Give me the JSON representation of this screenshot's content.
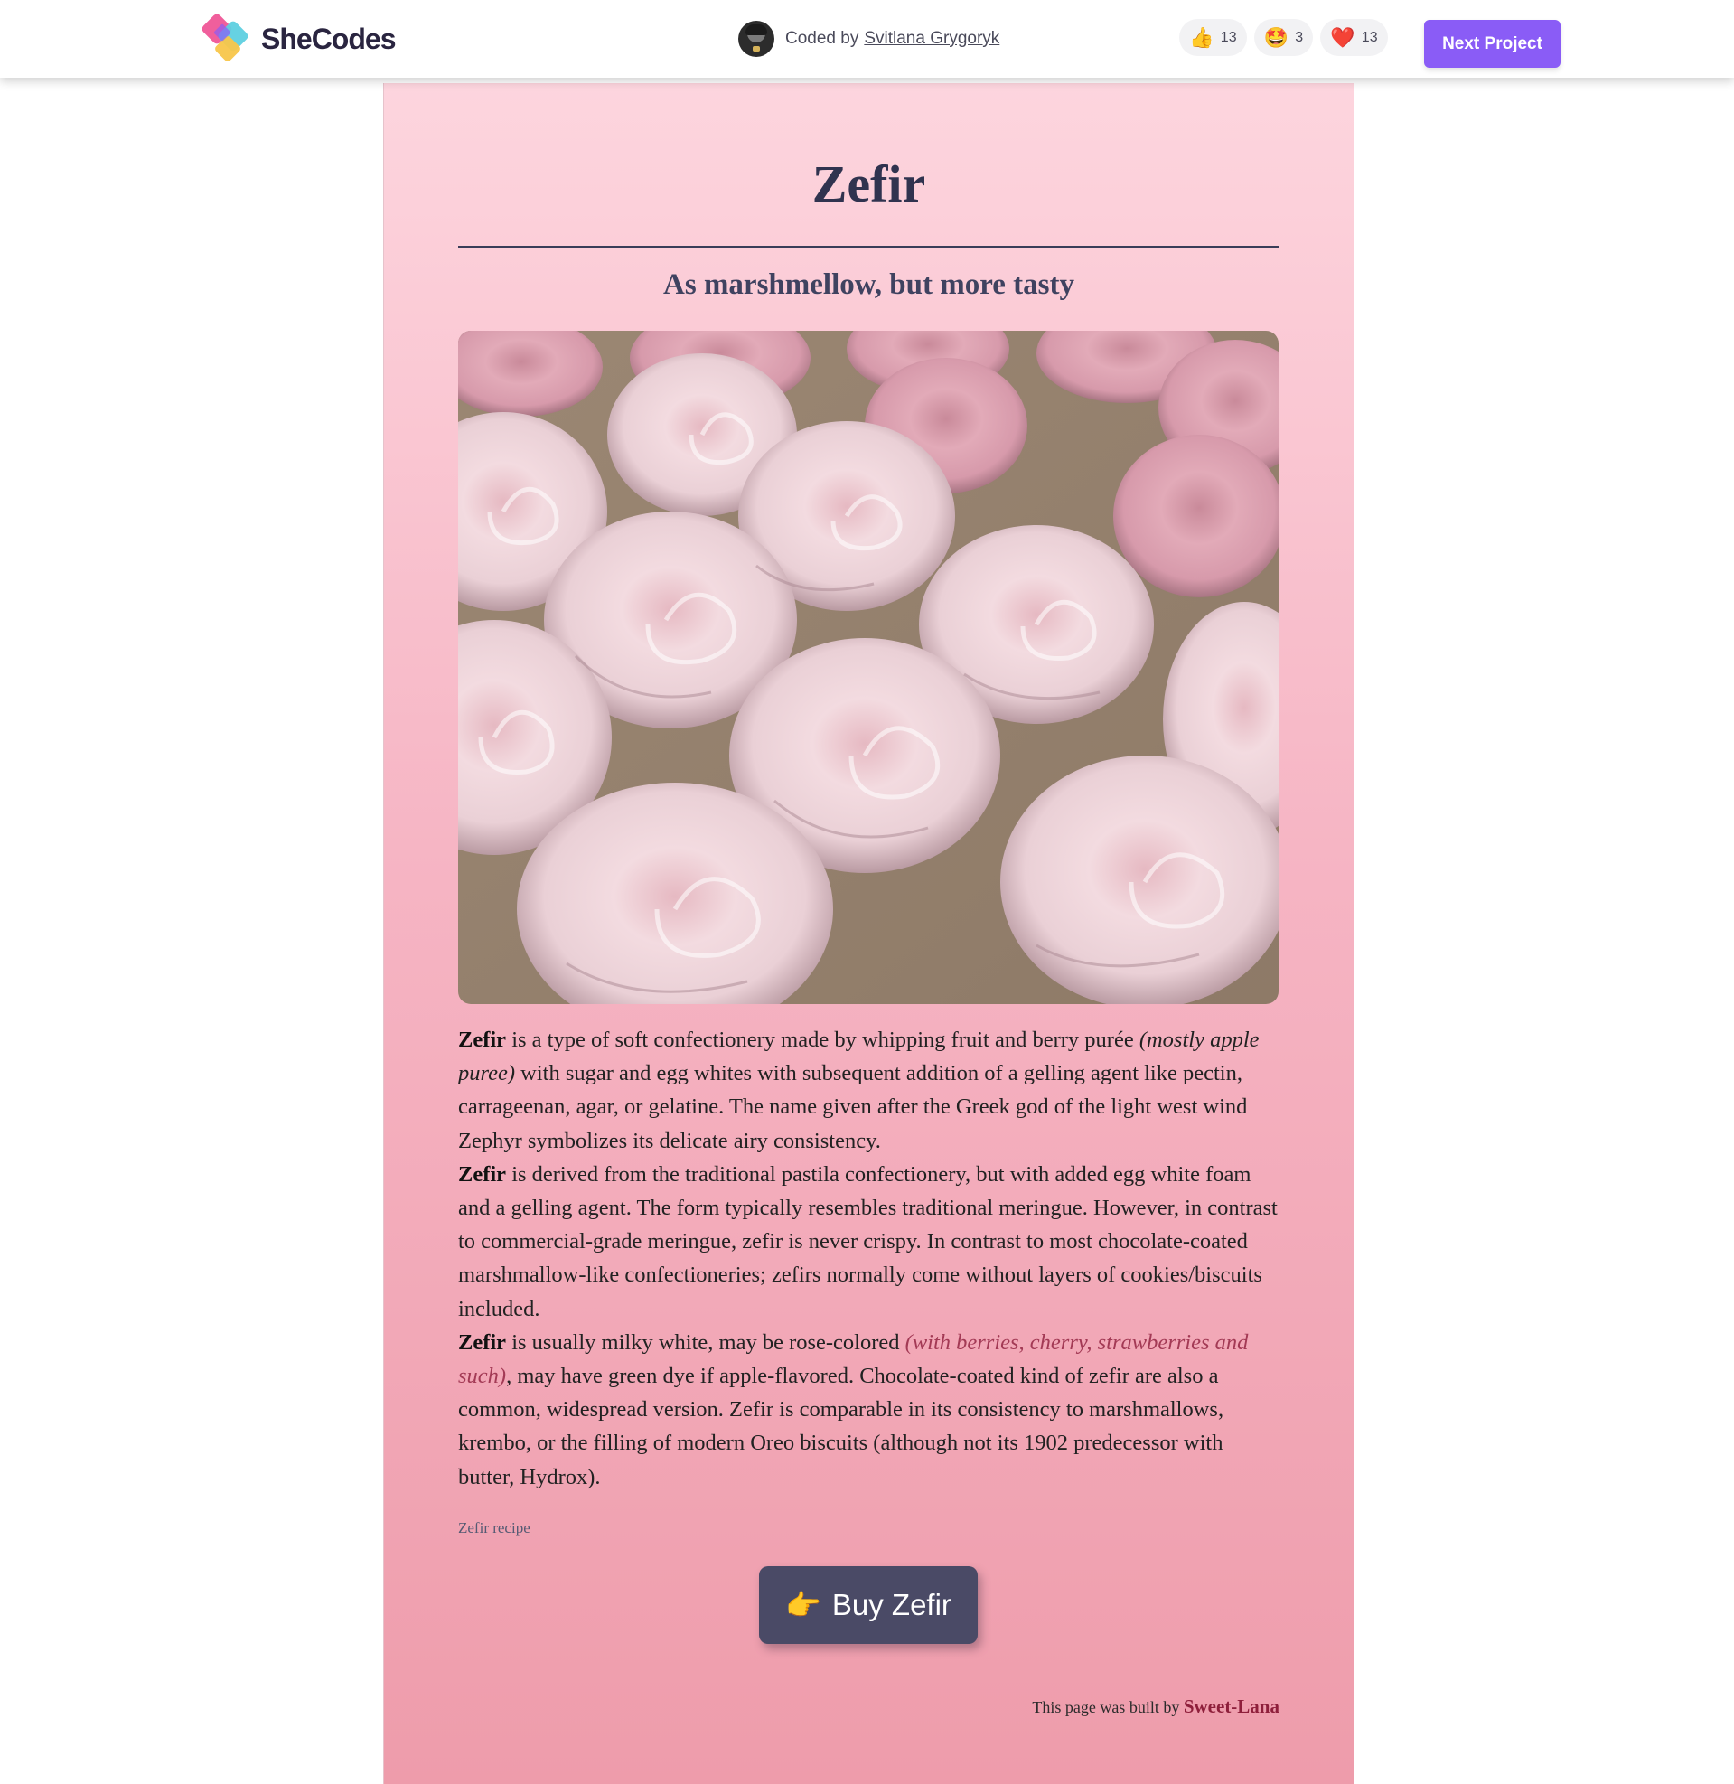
{
  "header": {
    "brand": "SheCodes",
    "coded_by_label": "Coded by",
    "author": "Svitlana Grygoryk",
    "reactions": [
      {
        "icon": "thumbs-up",
        "emoji": "👍",
        "count": "13"
      },
      {
        "icon": "star-struck",
        "emoji": "🤩",
        "count": "3"
      },
      {
        "icon": "heart",
        "emoji": "❤️",
        "count": "13"
      }
    ],
    "next_button": "Next Project"
  },
  "page": {
    "title": "Zefir",
    "subtitle": "As marshmellow, but more tasty",
    "paragraphs": [
      {
        "lead": "Zefir",
        "text_1": " is a type of soft confectionery made by whipping fruit and berry purée ",
        "aside": "(mostly apple puree)",
        "text_2": " with sugar and egg whites with subsequent addition of a gelling agent like pectin, carrageenan, agar, or gelatine. The name given after the Greek god of the light west wind Zephyr symbolizes its delicate airy consistency."
      },
      {
        "lead": "Zefir",
        "text_1": " is derived from the traditional pastila confectionery, but with added egg white foam and a gelling agent. The form typically resembles traditional meringue. However, in contrast to commercial-grade meringue, zefir is never crispy. In contrast to most chocolate-coated marshmallow-like confectioneries; zefirs normally come without layers of cookies/biscuits included."
      },
      {
        "lead": "Zefir",
        "text_1": " is usually milky white, may be rose-colored ",
        "aside": "(with berries, cherry, strawberries and such)",
        "text_2": ", may have green dye if apple-flavored. Chocolate-coated kind of zefir are also a common, widespread version. Zefir is comparable in its consistency to marshmallows, krembo, or the filling of modern Oreo biscuits (although not its 1902 predecessor with butter, Hydrox)."
      }
    ],
    "recipe_link": "Zefir recipe",
    "buy_button": {
      "icon": "pointing-finger",
      "emoji": "👉",
      "label": "Buy Zefir"
    },
    "footer_prefix": "This page was built by",
    "footer_builder": "Sweet-Lana"
  },
  "colors": {
    "accent": "#8a5cf6",
    "title": "#30334f",
    "button": "#4a4a66",
    "card_top": "#fdd5de",
    "card_bottom": "#ee9cab",
    "builder": "#8e1f3b"
  }
}
